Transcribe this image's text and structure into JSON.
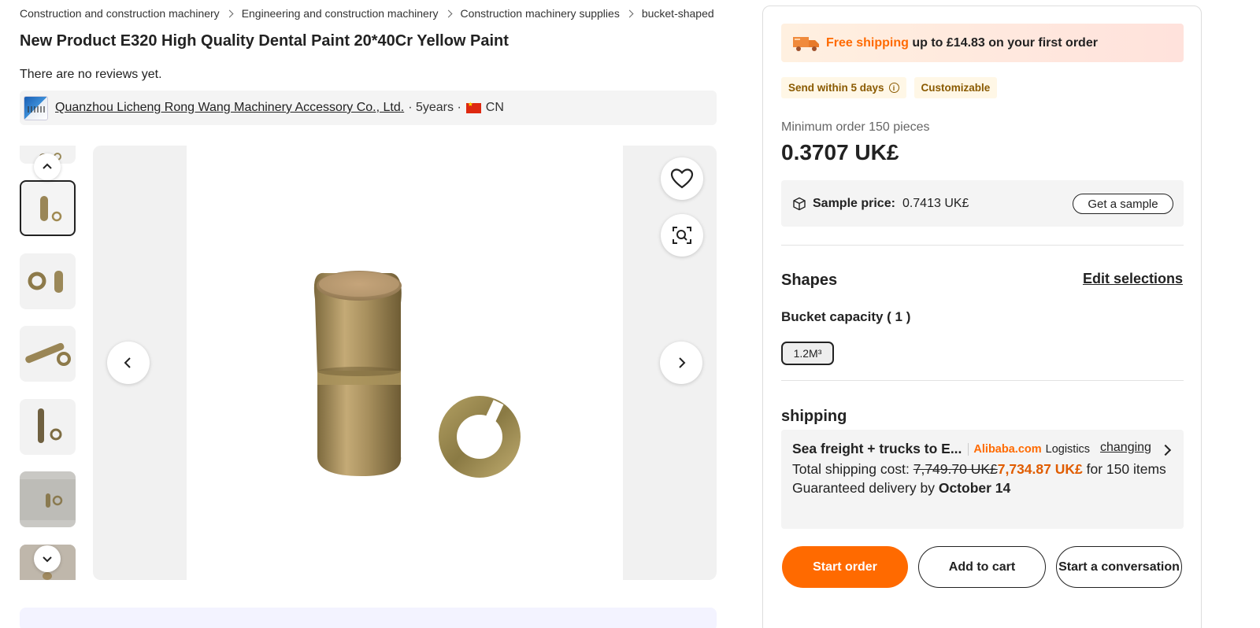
{
  "breadcrumb": [
    "Construction and construction machinery",
    "Engineering and construction machinery",
    "Construction machinery supplies",
    "bucket-shaped"
  ],
  "product": {
    "title": "New Product E320 High Quality Dental Paint 20*40Cr Yellow Paint",
    "reviews_text": "There are no reviews yet."
  },
  "supplier": {
    "name": "Quanzhou Licheng Rong Wang Machinery Accessory Co., Ltd.",
    "years": "· 5years ·",
    "country": "CN"
  },
  "gallery": {
    "thumb_count": 7,
    "active_index": 1,
    "icons": [
      "chevron-up-icon",
      "chevron-down-icon",
      "chevron-left-icon",
      "chevron-right-icon",
      "heart-icon",
      "image-search-icon"
    ]
  },
  "shipping_banner": {
    "highlight": "Free shipping",
    "rest": " up to £14.83 on your first order"
  },
  "tags": {
    "dispatch": "Send within 5 days",
    "customizable": "Customizable"
  },
  "pricing": {
    "min_order": "Minimum order 150 pieces",
    "price": "0.3707 UK£",
    "sample_label": "Sample price:",
    "sample_value": "0.7413 UK£",
    "sample_button": "Get a sample"
  },
  "shapes": {
    "heading": "Shapes",
    "edit_label": "Edit selections",
    "capacity_label": "Bucket capacity ( 1 )",
    "options": [
      "1.2M³"
    ]
  },
  "shipping": {
    "heading": "shipping",
    "method": "Sea freight + trucks to E...",
    "brand": "Alibaba.com",
    "brand_suffix": "Logistics",
    "change_label": "changing",
    "cost_label": "Total shipping cost:",
    "old_cost": "7,749.70 UK£",
    "new_cost": "7,734.87 UK£",
    "cost_suffix": "for 150 items",
    "delivery_label": "Guaranteed delivery by",
    "delivery_date": "October 14"
  },
  "actions": {
    "start_order": "Start order",
    "add_to_cart": "Add to cart",
    "conversation": "Start a conversation"
  },
  "colors": {
    "accent": "#ff6a00",
    "price_orange": "#e05c00",
    "tag_bg": "#fff7e6"
  }
}
